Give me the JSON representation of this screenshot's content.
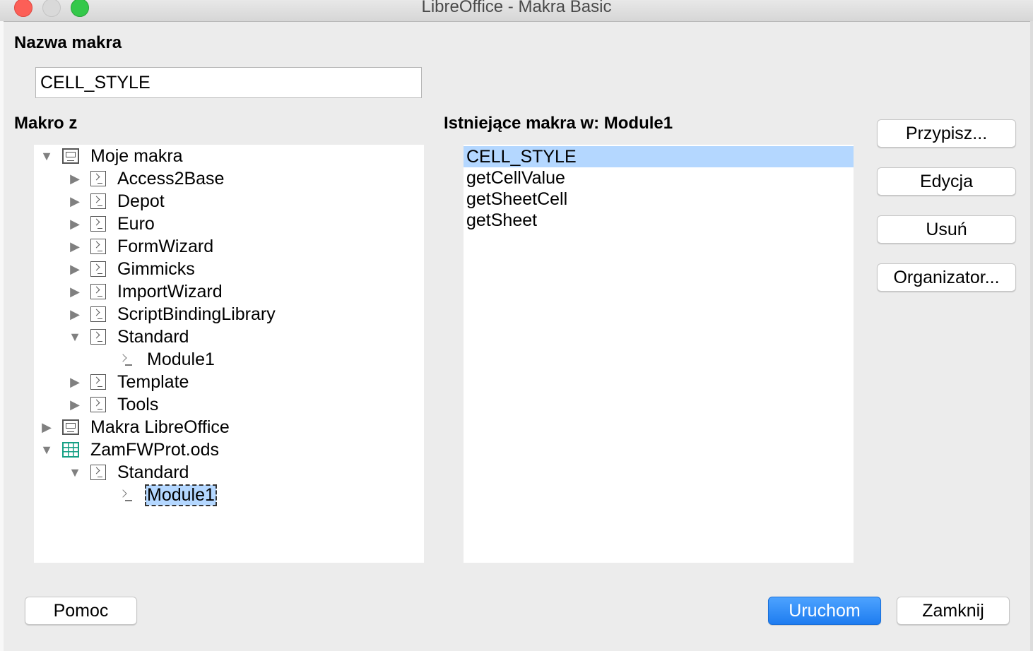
{
  "window": {
    "title": "LibreOffice - Makra Basic"
  },
  "macro_name": {
    "label": "Nazwa makra",
    "value": "CELL_STYLE"
  },
  "macro_from": {
    "label": "Makro z",
    "tree": [
      {
        "label": "Moje makra",
        "icon": "computer-icon",
        "expanded": true
      },
      {
        "label": "Access2Base",
        "icon": "library-icon",
        "expanded": false
      },
      {
        "label": "Depot",
        "icon": "library-icon",
        "expanded": false
      },
      {
        "label": "Euro",
        "icon": "library-icon",
        "expanded": false
      },
      {
        "label": "FormWizard",
        "icon": "library-icon",
        "expanded": false
      },
      {
        "label": "Gimmicks",
        "icon": "library-icon",
        "expanded": false
      },
      {
        "label": "ImportWizard",
        "icon": "library-icon",
        "expanded": false
      },
      {
        "label": "ScriptBindingLibrary",
        "icon": "library-icon",
        "expanded": false
      },
      {
        "label": "Standard",
        "icon": "library-icon",
        "expanded": true
      },
      {
        "label": "Module1",
        "icon": "module-icon"
      },
      {
        "label": "Template",
        "icon": "library-icon",
        "expanded": false
      },
      {
        "label": "Tools",
        "icon": "library-icon",
        "expanded": false
      },
      {
        "label": "Makra LibreOffice",
        "icon": "computer-icon",
        "expanded": false
      },
      {
        "label": "ZamFWProt.ods",
        "icon": "spreadsheet-icon",
        "expanded": true
      },
      {
        "label": "Standard",
        "icon": "library-icon",
        "expanded": true
      },
      {
        "label": "Module1",
        "icon": "module-icon",
        "selected": true
      }
    ]
  },
  "existing_macros": {
    "label": "Istniejące makra w: Module1",
    "items": [
      "CELL_STYLE",
      "getCellValue",
      "getSheetCell",
      "getSheet"
    ],
    "selected": "CELL_STYLE"
  },
  "buttons": {
    "assign": "Przypisz...",
    "edit": "Edycja",
    "delete": "Usuń",
    "organizer": "Organizator...",
    "help": "Pomoc",
    "run": "Uruchom",
    "close": "Zamknij"
  },
  "colors": {
    "selection": "#b4d7ff",
    "default_button": "#1e7cf0"
  }
}
